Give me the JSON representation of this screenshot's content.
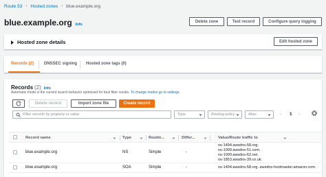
{
  "breadcrumb": [
    "Route 53",
    "Hosted zones",
    "blue.example.org"
  ],
  "zone_title": "blue.example.org",
  "info_label": "Info",
  "header_buttons": {
    "delete": "Delete zone",
    "test": "Test record",
    "query_logging": "Configure query logging"
  },
  "details": {
    "title": "Hosted zone details",
    "edit_button": "Edit hosted zone"
  },
  "tabs": [
    "Records (2)",
    "DNSSEC signing",
    "Hosted zone tags (0)"
  ],
  "records": {
    "title": "Records",
    "count": "(2)",
    "info": "Info",
    "description": "Automatic mode is the current search behavior optimized for best filter results.",
    "description_link": "To change modes go to settings.",
    "delete_button": "Delete record",
    "import_button": "Import zone file",
    "create_button": "Create record",
    "search_placeholder": "Filter records by property or value",
    "type_placeholder": "Type",
    "policy_placeholder": "Routing policy",
    "alias_placeholder": "Alias",
    "page": "1"
  },
  "table": {
    "columns": [
      "Record name",
      "Type",
      "Routin...",
      "Differ...",
      "Value/Route traffic to"
    ],
    "rows": [
      {
        "name": "blue.example.org",
        "type": "NS",
        "routing": "Simple",
        "differ": "-",
        "values": [
          "ns-1494.awsdns-58.org.",
          "ns-1009.awsdns-51.com.",
          "ns-1009.awsdns-62.net.",
          "ns-1853.awsdns-39.co.uk."
        ]
      },
      {
        "name": "blue.example.org",
        "type": "SOA",
        "routing": "Simple",
        "differ": "-",
        "values": [
          "ns-1494.awsdns-58.org. awsdns-hostmaster.amazon.com."
        ]
      }
    ]
  },
  "colors": {
    "accent": "#ec7211",
    "link": "#0073bb",
    "text": "#16191f",
    "muted": "#545b64",
    "background": "#f2f3f3"
  },
  "icons": [
    "refresh-icon",
    "search-icon",
    "caret-down-icon",
    "chevron-left-icon",
    "chevron-right-icon",
    "gear-icon",
    "caret-right-icon",
    "sort-icon"
  ]
}
